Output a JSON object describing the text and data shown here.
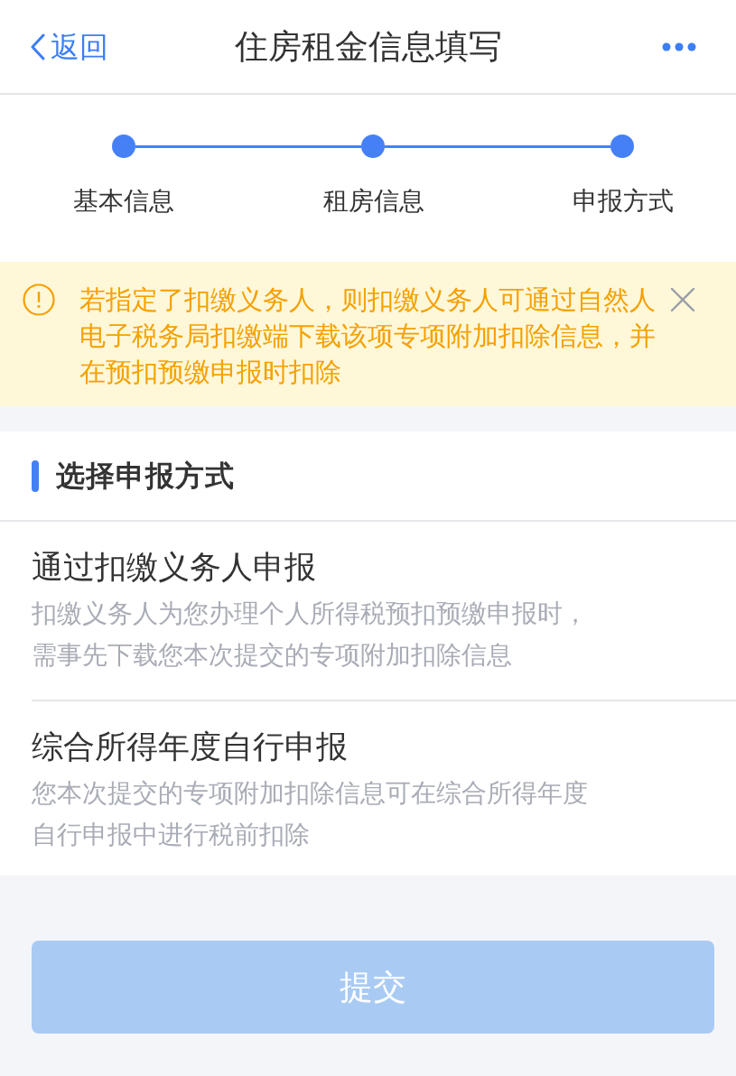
{
  "nav": {
    "back_label": "返回",
    "title": "住房租金信息填写"
  },
  "steps": [
    {
      "label": "基本信息",
      "completed": true
    },
    {
      "label": "租房信息",
      "completed": true
    },
    {
      "label": "申报方式",
      "completed": true
    }
  ],
  "notice": {
    "text": "若指定了扣缴义务人，则扣缴义务人可通过自然人电子税务局扣缴端下载该项专项附加扣除信息，并在预扣预缴申报时扣除",
    "dismissible": true
  },
  "section": {
    "title": "选择申报方式",
    "options": [
      {
        "title": "通过扣缴义务人申报",
        "description": "扣缴义务人为您办理个人所得税预扣预缴申报时，需事先下载您本次提交的专项附加扣除信息"
      },
      {
        "title": "综合所得年度自行申报",
        "description": "您本次提交的专项附加扣除信息可在综合所得年度自行申报中进行税前扣除"
      }
    ]
  },
  "submit_button": {
    "label": "提交",
    "disabled": true
  }
}
